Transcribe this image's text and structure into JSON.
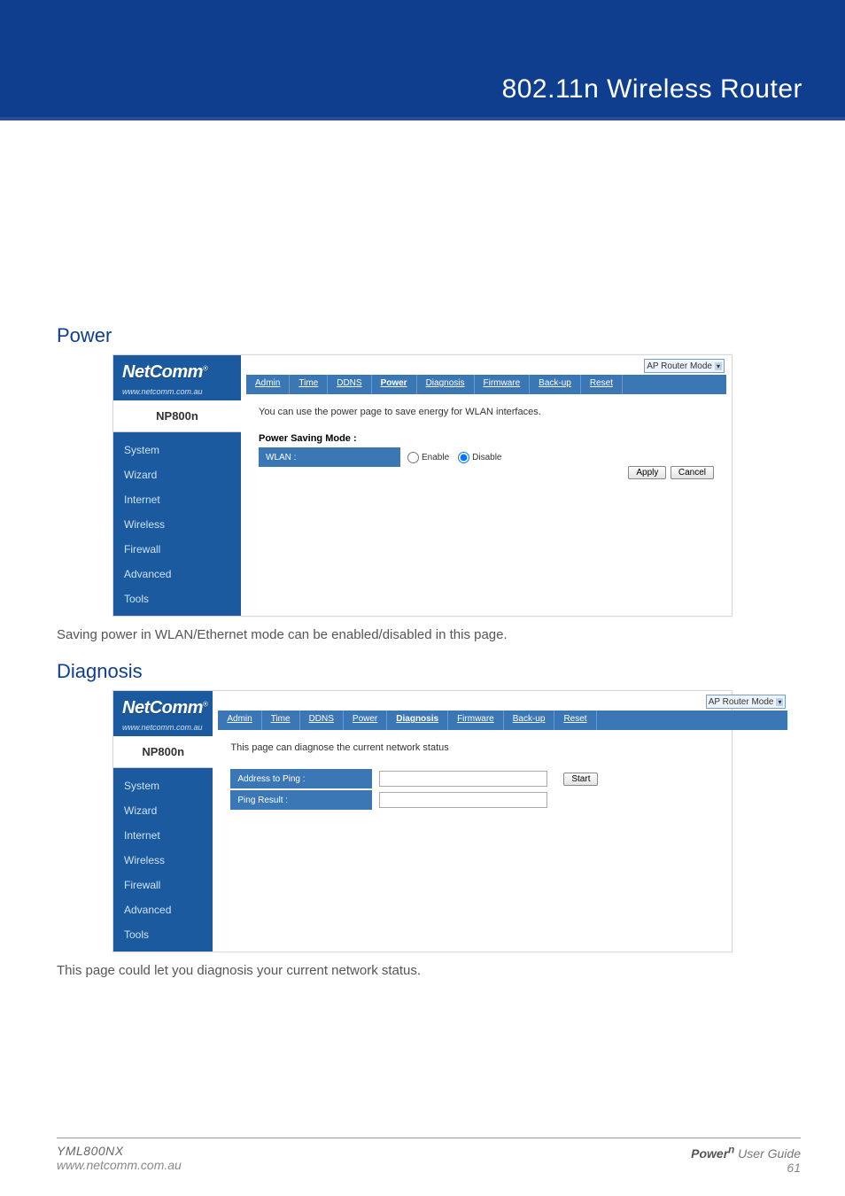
{
  "header": {
    "title": "802.11n Wireless Router"
  },
  "sections": {
    "power": {
      "heading": "Power",
      "caption": "Saving power in WLAN/Ethernet mode can be enabled/disabled in this page."
    },
    "diagnosis": {
      "heading": "Diagnosis",
      "caption": "This page could let you diagnosis your current network status."
    }
  },
  "router_ui": {
    "brand": "NetComm",
    "brand_suffix": "®",
    "brand_url": "www.netcomm.com.au",
    "model": "NP800n",
    "mode_selector": "AP Router Mode",
    "sidebar": [
      "System",
      "Wizard",
      "Internet",
      "Wireless",
      "Firewall",
      "Advanced",
      "Tools"
    ],
    "tabs": [
      "Admin",
      "Time",
      "DDNS",
      "Power",
      "Diagnosis",
      "Firmware",
      "Back-up",
      "Reset"
    ],
    "power_page": {
      "description": "You can use the power page to save energy for WLAN interfaces.",
      "group_label": "Power Saving Mode :",
      "row_label": "WLAN :",
      "options": {
        "enable": "Enable",
        "disable": "Disable"
      },
      "selected": "disable",
      "buttons": {
        "apply": "Apply",
        "cancel": "Cancel"
      }
    },
    "diagnosis_page": {
      "description": "This page can diagnose the current network status",
      "rows": {
        "address": "Address to Ping :",
        "result": "Ping Result :"
      },
      "start": "Start"
    }
  },
  "footer": {
    "left_model": "YML800NX",
    "left_url": "www.netcomm.com.au",
    "right_product": "Power",
    "right_product_sup": "n",
    "right_label": " User Guide",
    "page_number": "61"
  }
}
